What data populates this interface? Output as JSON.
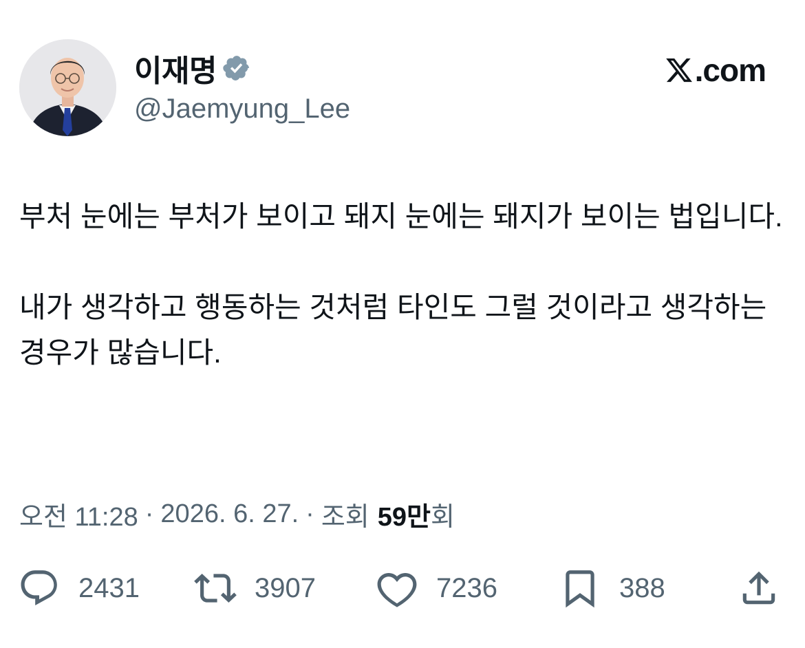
{
  "author": {
    "name": "이재명",
    "handle": "@Jaemyung_Lee",
    "verified": true,
    "avatar_icon": "profile-photo"
  },
  "brand": {
    "logo_text": ".com",
    "logo_icon": "x-logo-icon"
  },
  "post": {
    "paragraphs": [
      "부처 눈에는 부처가 보이고 돼지 눈에는 돼지가 보이는 법입니다.",
      "내가 생각하고 행동하는 것처럼 타인도 그럴 것이라고 생각하는 경우가 많습니다."
    ]
  },
  "meta": {
    "time": "오전 11:28",
    "separator": "·",
    "date": "2026. 6. 27.",
    "views_label": "조회",
    "views_count": "59만",
    "views_suffix": "회"
  },
  "actions": {
    "replies": "2431",
    "reposts": "3907",
    "likes": "7236",
    "bookmarks": "388"
  },
  "colors": {
    "text": "#0f1419",
    "secondary": "#536471",
    "verified_badge": "#829aab"
  }
}
